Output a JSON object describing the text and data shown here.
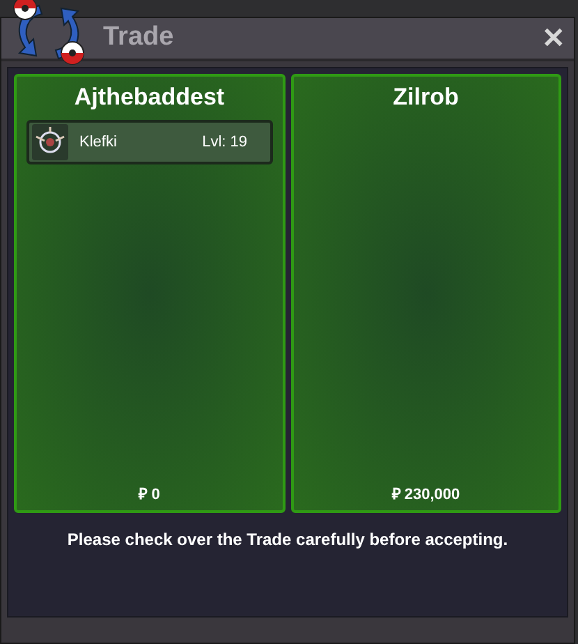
{
  "window": {
    "title": "Trade",
    "close": "✕"
  },
  "sides": [
    {
      "player": "Ajthebaddest",
      "items": [
        {
          "name": "Klefki",
          "level": "Lvl: 19"
        }
      ],
      "money": "₽ 0"
    },
    {
      "player": "Zilrob",
      "money": "₽ 230,000"
    }
  ],
  "message": "Please check over the Trade carefully before accepting."
}
